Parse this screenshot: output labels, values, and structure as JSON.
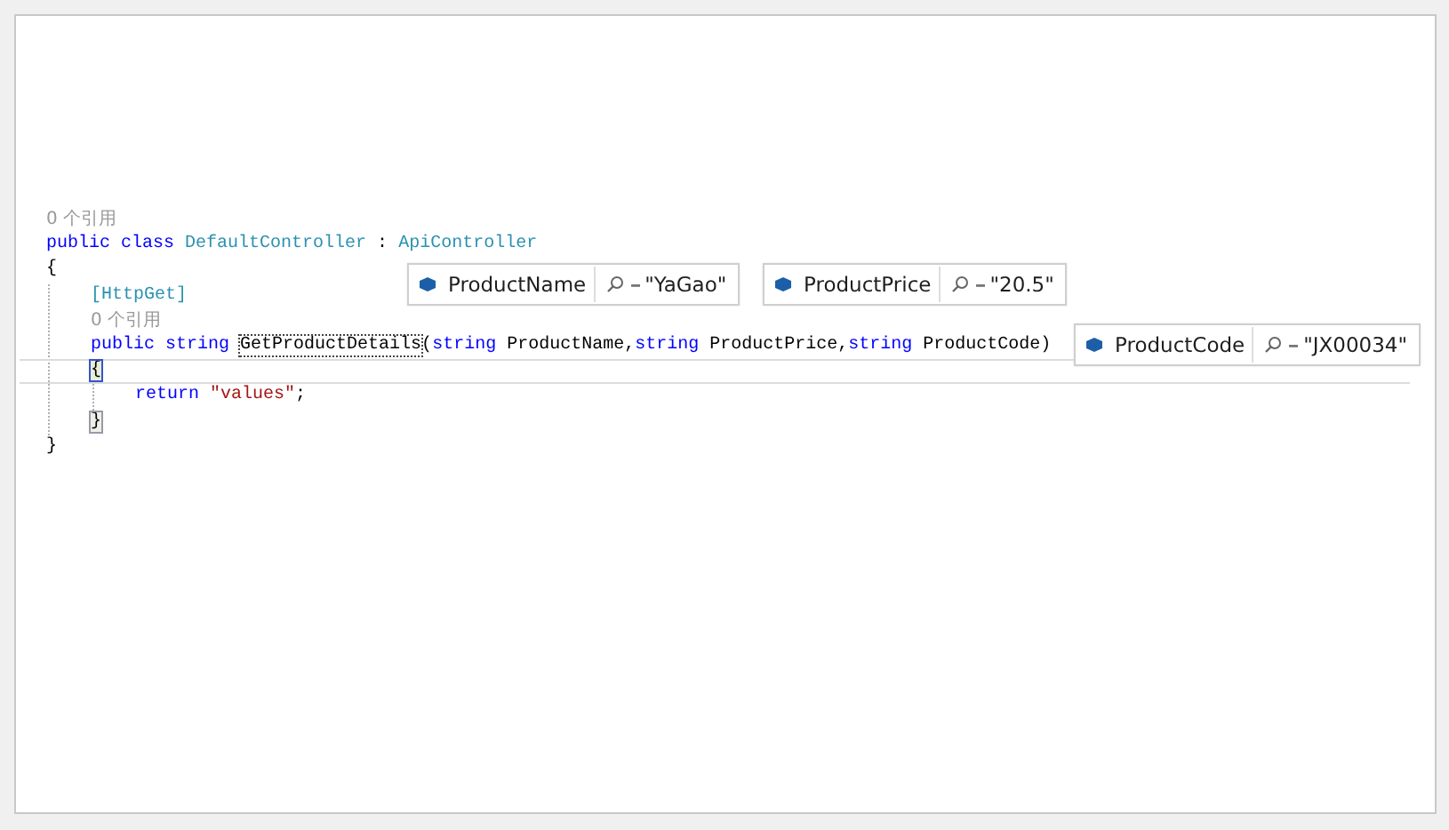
{
  "editor": {
    "lines": [
      {
        "kind": "lens",
        "tokens": [
          {
            "kind": "lens",
            "text": "0 个引用"
          }
        ]
      },
      {
        "kind": "code",
        "tokens": [
          {
            "kind": "keyword",
            "text": "public class "
          },
          {
            "kind": "type",
            "text": "DefaultController"
          },
          {
            "kind": "plain",
            "text": " : "
          },
          {
            "kind": "type",
            "text": "ApiController"
          }
        ]
      },
      {
        "kind": "code",
        "tokens": [
          {
            "kind": "plain",
            "text": "{"
          }
        ],
        "children": [
          {
            "kind": "code",
            "tokens": [
              {
                "kind": "type",
                "text": "[HttpGet]"
              }
            ]
          },
          {
            "kind": "lens",
            "tokens": [
              {
                "kind": "lens",
                "text": "0 个引用"
              }
            ]
          },
          {
            "kind": "code",
            "tokens": [
              {
                "kind": "keyword",
                "text": "public string "
              },
              {
                "kind": "boxed",
                "text": "GetProductDetails"
              },
              {
                "kind": "plain",
                "text": "("
              },
              {
                "kind": "keyword",
                "text": "string "
              },
              {
                "kind": "plain",
                "text": "ProductName,"
              },
              {
                "kind": "keyword",
                "text": "string "
              },
              {
                "kind": "plain",
                "text": "ProductPrice,"
              },
              {
                "kind": "keyword",
                "text": "string "
              },
              {
                "kind": "plain",
                "text": "ProductCode)"
              }
            ]
          },
          {
            "kind": "code",
            "current": true,
            "tokens": [
              {
                "kind": "brace-match",
                "text": "{"
              }
            ],
            "children": [
              {
                "kind": "code",
                "tokens": [
                  {
                    "kind": "keyword",
                    "text": "return "
                  },
                  {
                    "kind": "string",
                    "text": "\"values\""
                  },
                  {
                    "kind": "plain",
                    "text": ";"
                  }
                ]
              }
            ]
          },
          {
            "kind": "code",
            "tokens": [
              {
                "kind": "brace-match",
                "text": "}"
              }
            ]
          }
        ]
      },
      {
        "kind": "code",
        "tokens": [
          {
            "kind": "plain",
            "text": "}"
          }
        ]
      }
    ]
  },
  "datatips": [
    {
      "name": "ProductName",
      "value": "\"YaGao\""
    },
    {
      "name": "ProductPrice",
      "value": "\"20.5\""
    },
    {
      "name": "ProductCode",
      "value": "\"JX00034\""
    }
  ]
}
